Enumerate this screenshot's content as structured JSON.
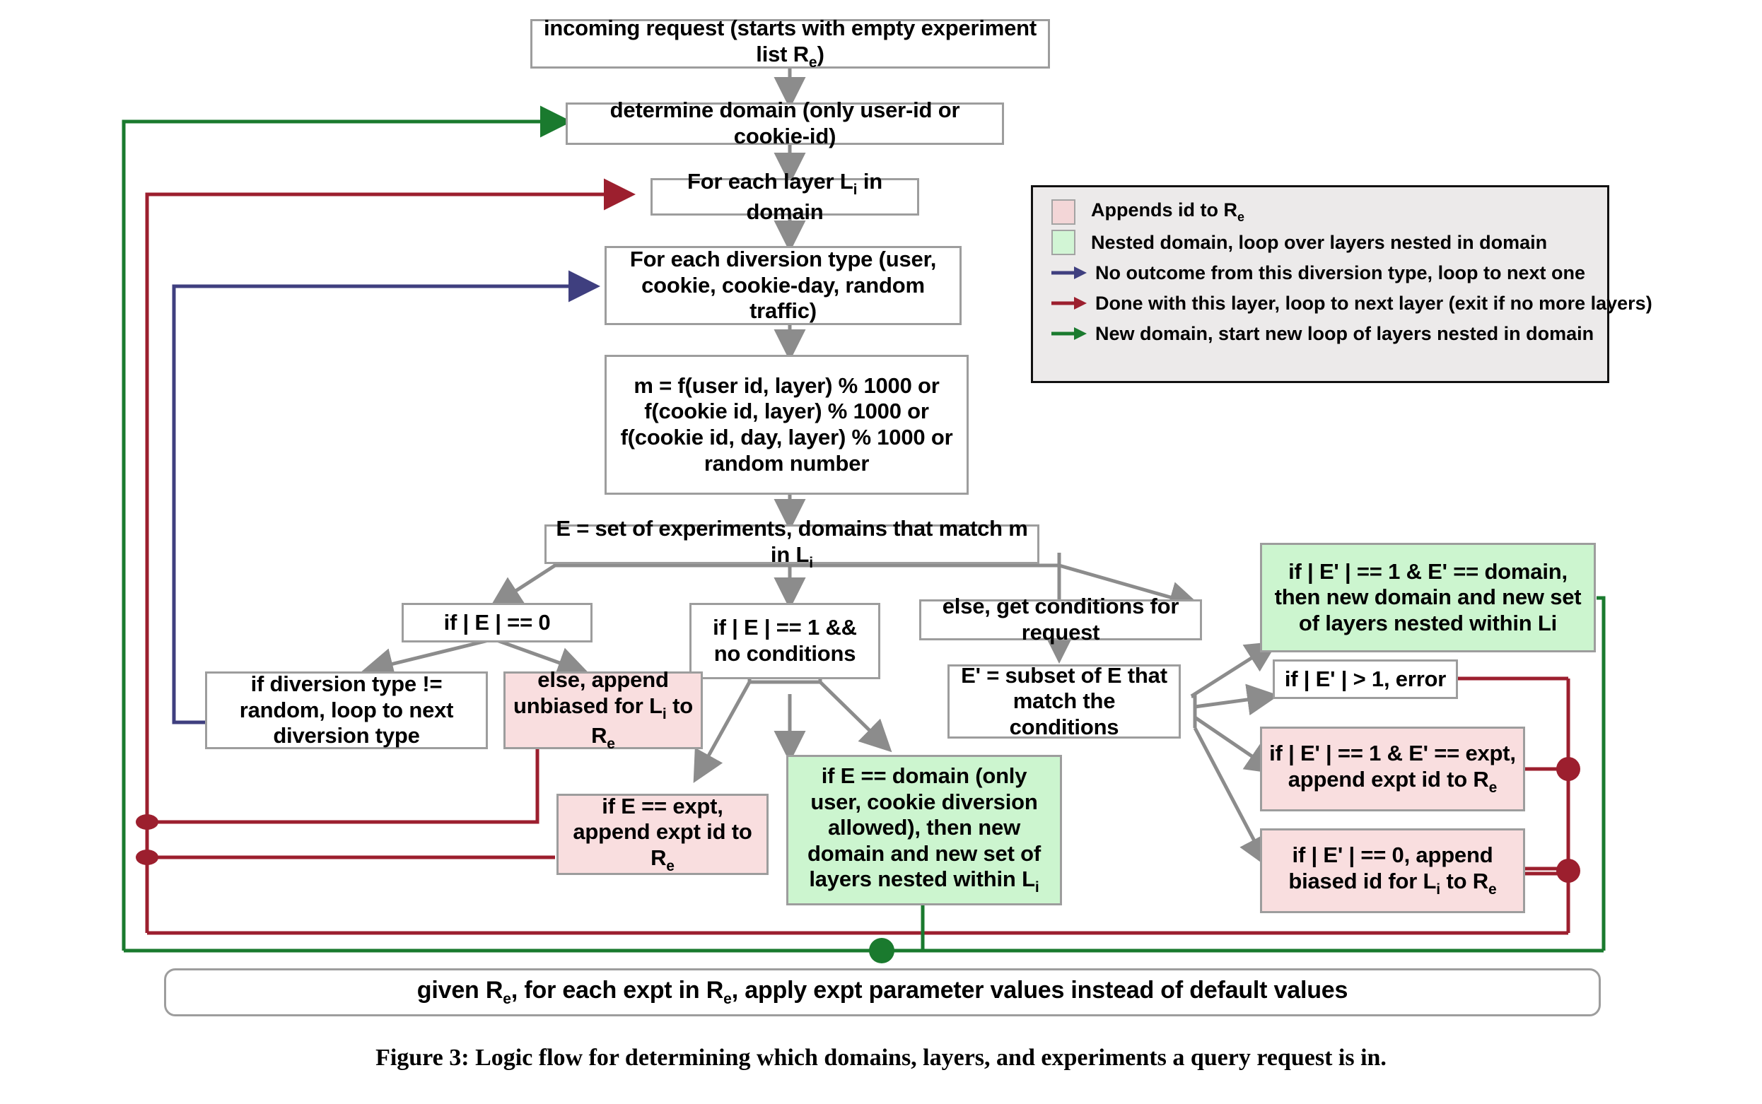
{
  "figure": {
    "caption": "Figure 3: Logic flow for determining which domains, layers, and experiments a query request is in."
  },
  "colors": {
    "pink_fill": "#f9dedf",
    "green_fill": "#ccf5cf",
    "box_border": "#9d9d9d",
    "gray_arrow": "#8c8c8c",
    "blue_arrow": "#3f3f7f",
    "dark_red_arrow": "#9c1f2e",
    "green_arrow": "#1a7a2e",
    "legend_bg": "#eceaea",
    "legend_border": "#111111"
  },
  "nodes": {
    "incoming_request": {
      "pre": "incoming request (starts with  empty experiment list R",
      "sub": "e",
      "post": ")"
    },
    "determine_domain": "determine domain (only user-id or cookie-id)",
    "for_each_layer": {
      "pre": "For each layer L",
      "sub": "i",
      "post": " in domain"
    },
    "for_each_diversion": "For each diversion type (user, cookie, cookie-day, random traffic)",
    "compute_m": "m = f(user id, layer) % 1000 or f(cookie id, layer) % 1000 or f(cookie id, day, layer) % 1000 or random number",
    "set_E": {
      "pre": "E = set of experiments, domains that match m in L",
      "sub": "i",
      "post": ""
    },
    "if_E_zero": "if  | E |  == 0",
    "if_E_one_nocond": "if  | E |  == 1 && no conditions",
    "else_get_conditions": "else, get conditions for request",
    "if_div_not_random": "if diversion type != random, loop to next diversion type",
    "else_append_unbiased": {
      "pre": "else, append unbiased for L",
      "sub": "i",
      "mid": " to R",
      "sub2": "e",
      "post": ""
    },
    "E_prime_subset": "E' = subset of E that match the conditions",
    "if_E_expt_append": {
      "pre": "if E == expt, append expt id to R",
      "sub": "e",
      "post": ""
    },
    "if_E_domain_nested": {
      "pre": "if E == domain (only user, cookie diversion allowed), then new domain and new set of layers nested within L",
      "sub": "i",
      "post": ""
    },
    "ep_one_domain": "if | E' |  == 1 & E' == domain, then new domain and new set of layers nested within Li",
    "ep_gt_one_error": "if  | E' | > 1, error",
    "ep_one_expt": {
      "pre": "if  | E' |  == 1 & E' == expt, append expt id to R",
      "sub": "e",
      "post": ""
    },
    "ep_zero_biased": {
      "pre": "if  | E' |  == 0, append biased id for L",
      "sub": "i",
      "mid": " to R",
      "sub2": "e",
      "post": ""
    },
    "apply_params": {
      "pre": "given R",
      "sub": "e",
      "mid": ", for each expt in R",
      "sub2": "e",
      "post": ", apply expt parameter values instead of default values"
    }
  },
  "legend": {
    "items": [
      {
        "kind": "swatch",
        "swatch": "pink",
        "icon": "pink-square-icon",
        "pre": "Appends id to R",
        "sub": "e",
        "post": ""
      },
      {
        "kind": "swatch",
        "swatch": "green",
        "icon": "green-square-icon",
        "pre": "Nested domain, loop over layers nested in domain",
        "sub": "",
        "post": ""
      },
      {
        "kind": "arrow",
        "color": "#3f3f7f",
        "icon": "blue-arrow-icon",
        "pre": "No outcome from this diversion type, loop to next one",
        "sub": "",
        "post": ""
      },
      {
        "kind": "arrow",
        "color": "#9c1f2e",
        "icon": "dark-red-arrow-icon",
        "pre": "Done with this layer, loop to next layer (exit if no more layers)",
        "sub": "",
        "post": ""
      },
      {
        "kind": "arrow",
        "color": "#1a7a2e",
        "icon": "green-arrow-icon",
        "pre": "New domain, start new loop of layers nested in domain",
        "sub": "",
        "post": ""
      }
    ]
  }
}
